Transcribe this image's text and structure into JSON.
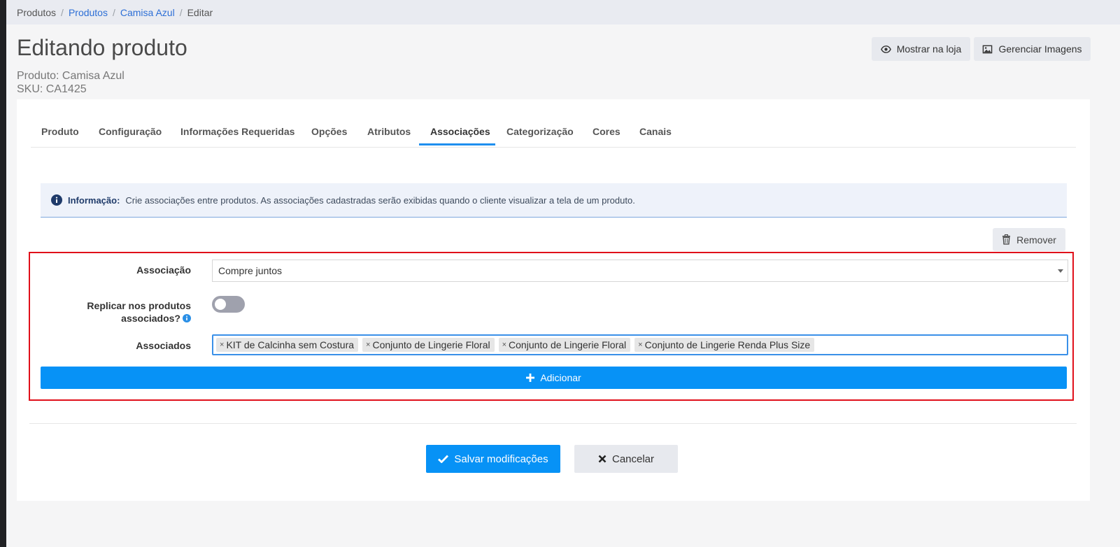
{
  "breadcrumb": {
    "items": [
      "Produtos",
      "Produtos",
      "Camisa Azul",
      "Editar"
    ],
    "separator": "/"
  },
  "header": {
    "title": "Editando produto",
    "product_line": "Produto: Camisa Azul",
    "sku_line": "SKU: CA1425",
    "show_in_store_label": "Mostrar na loja",
    "manage_images_label": "Gerenciar Imagens"
  },
  "tabs": [
    {
      "label": "Produto",
      "active": false
    },
    {
      "label": "Configuração",
      "active": false
    },
    {
      "label": "Informações Requeridas",
      "active": false
    },
    {
      "label": "Opções",
      "active": false
    },
    {
      "label": "Atributos",
      "active": false
    },
    {
      "label": "Associações",
      "active": true
    },
    {
      "label": "Categorização",
      "active": false
    },
    {
      "label": "Cores",
      "active": false
    },
    {
      "label": "Canais",
      "active": false
    }
  ],
  "info": {
    "label": "Informação:",
    "text": "Crie associações entre produtos. As associações cadastradas serão exibidas quando o cliente visualizar a tela de um produto."
  },
  "remove_label": "Remover",
  "form": {
    "association_label": "Associação",
    "association_value": "Compre juntos",
    "replicate_label_line1": "Replicar nos produtos",
    "replicate_label_line2": "associados?",
    "replicate_enabled": false,
    "associated_label": "Associados",
    "associated_tags": [
      "KIT de Calcinha sem Costura",
      "Conjunto de Lingerie Floral",
      "Conjunto de Lingerie Floral",
      "Conjunto de Lingerie Renda Plus Size"
    ],
    "tag_remove_glyph": "×",
    "add_label": "Adicionar"
  },
  "footer": {
    "save_label": "Salvar modificações",
    "cancel_label": "Cancelar"
  },
  "colors": {
    "primary": "#0792f6",
    "highlight_border": "#e0101a",
    "link": "#2d6fd6"
  }
}
